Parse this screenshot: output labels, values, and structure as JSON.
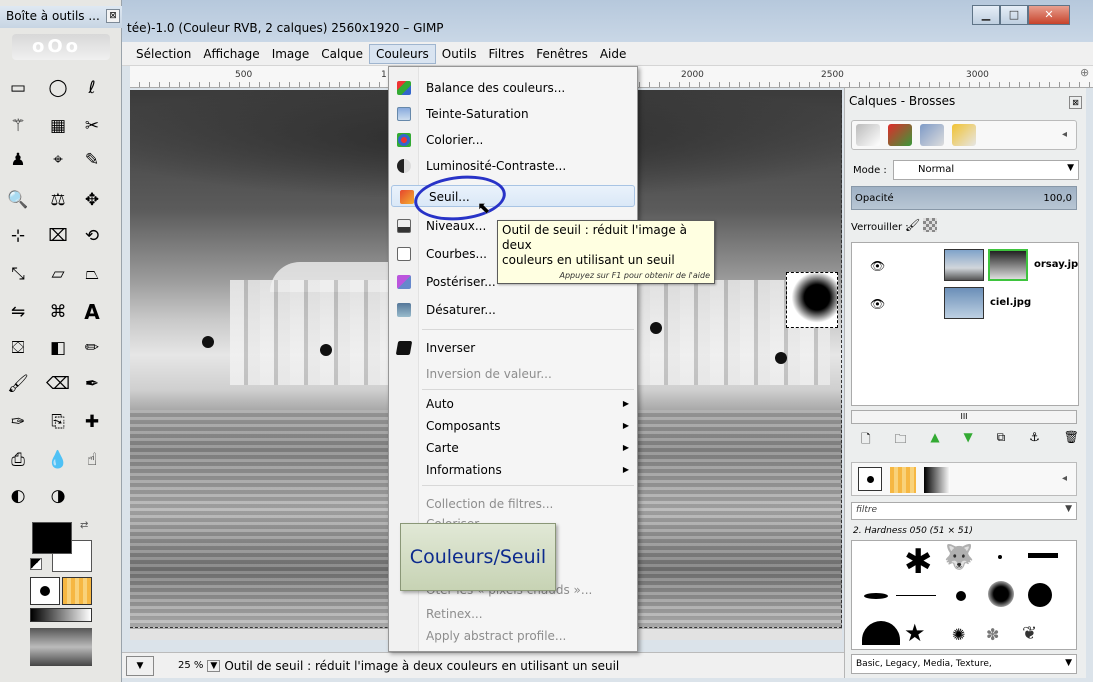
{
  "toolbox": {
    "title": "Boîte à outils ...",
    "close_label": "⊠",
    "tools": [
      "rect-select",
      "ellipse-select",
      "free-select",
      "fuzzy-select",
      "select-by-color",
      "scissors",
      "foreground-select",
      "paths",
      "color-picker",
      "zoom",
      "measure",
      "move",
      "align",
      "crop",
      "rotate",
      "scale",
      "shear",
      "perspective",
      "flip",
      "text",
      "bucket-fill",
      "blend",
      "pencil",
      "paintbrush",
      "eraser",
      "airbrush",
      "ink",
      "clone",
      "heal",
      "perspective-clone",
      "blur",
      "smudge",
      "dodge-burn"
    ]
  },
  "window": {
    "title": "tée)-1.0 (Couleur RVB, 2 calques) 2560x1920 – GIMP",
    "minimize_label": "▁",
    "maximize_label": "□",
    "close_label": "✕"
  },
  "menubar": {
    "items": [
      "Sélection",
      "Affichage",
      "Image",
      "Calque",
      "Couleurs",
      "Outils",
      "Filtres",
      "Fenêtres",
      "Aide"
    ]
  },
  "ruler": {
    "labels": [
      "500",
      "1",
      "2000",
      "2500",
      "3000"
    ]
  },
  "dropdown": {
    "items": [
      {
        "label": "Balance des couleurs...",
        "enabled": true
      },
      {
        "label": "Teinte-Saturation",
        "enabled": true
      },
      {
        "label": "Colorier...",
        "enabled": true
      },
      {
        "label": "Luminosité-Contraste...",
        "enabled": true
      },
      {
        "label": "Seuil...",
        "enabled": true,
        "highlighted": true
      },
      {
        "label": "Niveaux...",
        "enabled": true
      },
      {
        "label": "Courbes...",
        "enabled": true
      },
      {
        "label": "Postériser...",
        "enabled": true
      },
      {
        "label": "Désaturer...",
        "enabled": true
      },
      {
        "label": "Inverser",
        "enabled": true
      },
      {
        "label": "Inversion de valeur...",
        "enabled": false
      },
      {
        "label": "Auto",
        "enabled": true,
        "submenu": true
      },
      {
        "label": "Composants",
        "enabled": true,
        "submenu": true
      },
      {
        "label": "Carte",
        "enabled": true,
        "submenu": true
      },
      {
        "label": "Informations",
        "enabled": true,
        "submenu": true
      },
      {
        "label": "Collection de filtres...",
        "enabled": false
      },
      {
        "label": "Coloriser...",
        "enabled": false
      },
      {
        "label": "Ôter les « pixels chauds »...",
        "enabled": false
      },
      {
        "label": "Retinex...",
        "enabled": false
      },
      {
        "label": "Apply abstract profile...",
        "enabled": false
      }
    ]
  },
  "tooltip": {
    "line1": "Outil de seuil : réduit l'image à deux",
    "line2": "couleurs en utilisant un seuil",
    "hint": "Appuyez sur F1 pour obtenir de l'aide"
  },
  "callout": {
    "text": "Couleurs/Seuil"
  },
  "statusbar": {
    "zoom": "25 %",
    "zoom_arrow": "▼",
    "nav_arrow": "▼",
    "message": "Outil de seuil : réduit l'image à deux couleurs en utilisant un seuil"
  },
  "dock": {
    "title": "Calques - Brosses",
    "close_label": "⊠",
    "tab_menu": "◂",
    "mode_label": "Mode :",
    "mode_value": "Normal",
    "opacity_label": "Opacité",
    "opacity_value": "100,0",
    "lock_label": "Verrouiller :",
    "layers": [
      {
        "name": "orsay.jp",
        "visible": true
      },
      {
        "name": "ciel.jpg",
        "visible": true
      }
    ],
    "scroll_label": "III",
    "filter_placeholder": "filtre",
    "brush_name": "2. Hardness 050 (51 × 51)",
    "tags": "Basic, Legacy, Media, Texture,"
  },
  "colors": {
    "annotation": "#2833c7",
    "callout_text": "#0d2b8e",
    "tooltip_bg": "#ffffe1"
  }
}
